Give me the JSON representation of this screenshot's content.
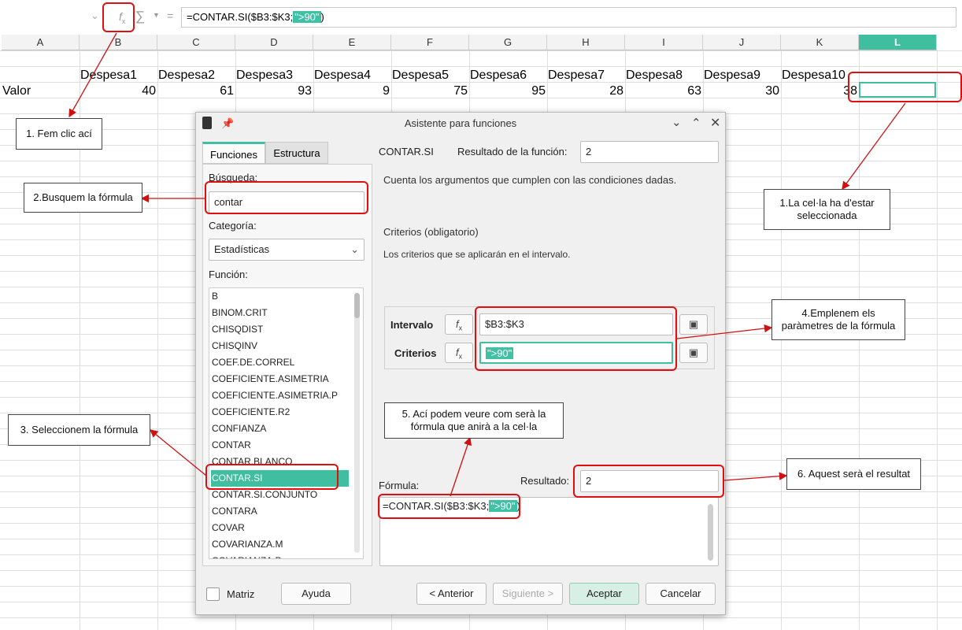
{
  "formula_bar": {
    "fx_icon": "fx-icon",
    "sum_icon": "sigma-icon",
    "equals": "=",
    "formula_prefix": "=CONTAR.SI($B3:$K3;",
    "formula_criteria": "\">90\"",
    "formula_suffix": ")"
  },
  "sheet": {
    "columns": [
      "A",
      "B",
      "C",
      "D",
      "E",
      "F",
      "G",
      "H",
      "I",
      "J",
      "K",
      "L"
    ],
    "selected_column": "L",
    "headers": [
      "Despesa1",
      "Despesa2",
      "Despesa3",
      "Despesa4",
      "Despesa5",
      "Despesa6",
      "Despesa7",
      "Despesa8",
      "Despesa9",
      "Despesa10"
    ],
    "row_label": "Valor",
    "values": [
      "40",
      "61",
      "93",
      "9",
      "75",
      "95",
      "28",
      "63",
      "30",
      "38"
    ]
  },
  "dialog": {
    "title": "Asistente para funciones",
    "tabs": [
      "Funciones",
      "Estructura"
    ],
    "search_label": "Búsqueda:",
    "search_value": "contar",
    "category_label": "Categoría:",
    "category_value": "Estadísticas",
    "function_label": "Función:",
    "functions": [
      "B",
      "BINOM.CRIT",
      "CHISQDIST",
      "CHISQINV",
      "COEF.DE.CORREL",
      "COEFICIENTE.ASIMETRIA",
      "COEFICIENTE.ASIMETRIA.P",
      "COEFICIENTE.R2",
      "CONFIANZA",
      "CONTAR",
      "CONTAR.BLANCO",
      "CONTAR.SI",
      "CONTAR.SI.CONJUNTO",
      "CONTARA",
      "COVAR",
      "COVARIANZA.M",
      "COVARIANZA.P"
    ],
    "selected_function": "CONTAR.SI",
    "func_name": "CONTAR.SI",
    "result_label": "Resultado de la función:",
    "result_value": "2",
    "description": "Cuenta los argumentos que cumplen con las condiciones dadas.",
    "arg_title": "Criterios (obligatorio)",
    "arg_desc": "Los criterios que se aplicarán en el intervalo.",
    "param1_label": "Intervalo",
    "param1_value": "$B3:$K3",
    "param2_label": "Criterios",
    "param2_value": "\">90\"",
    "formula_label": "Fórmula:",
    "formula_prefix": "=CONTAR.SI($B3:$K3;",
    "formula_criteria": "\">90\"",
    "formula_suffix": ")",
    "resultado_label": "Resultado:",
    "resultado_value": "2",
    "matriz_label": "Matriz",
    "buttons": {
      "ayuda": "Ayuda",
      "anterior": "< Anterior",
      "siguiente": "Siguiente >",
      "aceptar": "Aceptar",
      "cancelar": "Cancelar"
    }
  },
  "annotations": {
    "a1": "1. Fem clic ací",
    "a2": "2.Busquem la fórmula",
    "a3": "3. Seleccionem la fórmula",
    "a4": "4.Emplenem els paràmetres de la fórmula",
    "a5": "5. Ací podem veure com serà la fórmula que anirà a la cel·la",
    "a6": "6. Aquest serà el resultat",
    "a7": "1.La cel·la ha d'estar seleccionada"
  },
  "colors": {
    "accent": "#3fbf9f",
    "annotation_red": "#e01010"
  }
}
